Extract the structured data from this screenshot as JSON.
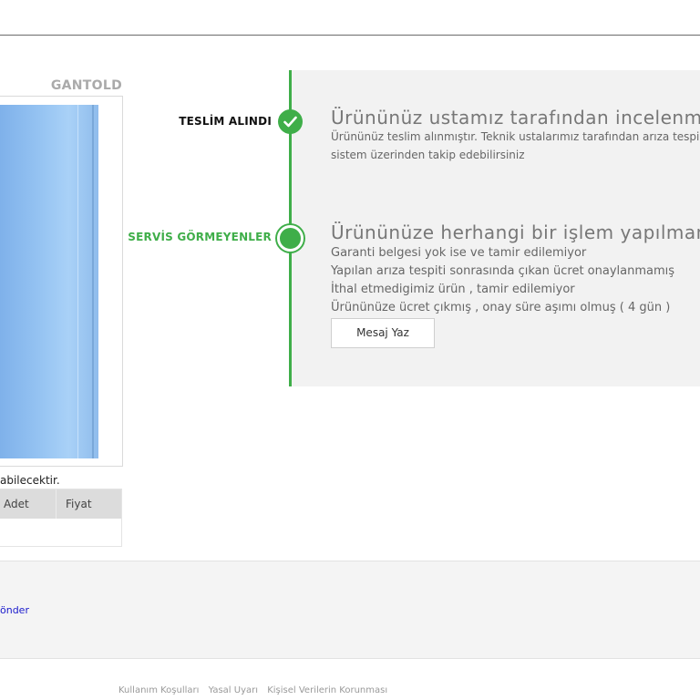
{
  "brand": "GANTOLD",
  "note": "abilecektir.",
  "table": {
    "headers": [
      "Adet",
      "Fiyat"
    ]
  },
  "steps": [
    {
      "label": "TESLİM ALINDI",
      "title": "Ürününüz ustamız tarafından incelenmek",
      "lines": [
        "Ürününüz teslim alınmıştır. Teknik ustalarımız tarafından arıza tespi",
        "sistem üzerinden takip edebilirsiniz"
      ],
      "status": "completed",
      "icon": "check-icon"
    },
    {
      "label": "SERVİS GÖRMEYENLER",
      "title": "Ürününüze herhangi bir işlem yapılmamı",
      "lines": [
        "Garanti belgesi yok ise ve tamir edilemiyor",
        "Yapılan arıza tespiti sonrasında çıkan ücret onaylanmamış",
        "İthal etmedigimiz ürün , tamir edilemiyor",
        "Ürününüze ücret çıkmış , onay süre aşımı olmuş ( 4 gün )"
      ],
      "status": "current",
      "button": "Mesaj Yaz"
    }
  ],
  "footer": {
    "link": "önder"
  },
  "bottom_links": [
    "Kullanım Koşulları",
    "Yasal Uyarı",
    "Kişisel Verilerin Korunması"
  ],
  "colors": {
    "accent": "#3fae49",
    "panel": "#f2f2f2"
  }
}
